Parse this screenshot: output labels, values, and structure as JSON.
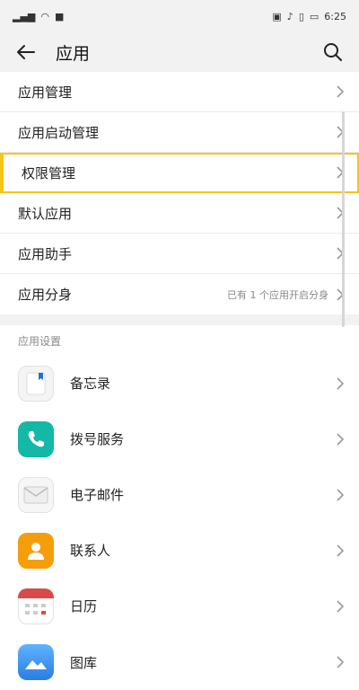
{
  "status": {
    "time": "6:25",
    "left_icons": [
      "signal-icon",
      "wifi-icon",
      "notification-icon"
    ],
    "right_icons": [
      "screenshot-icon",
      "mute-icon",
      "vibrate-icon",
      "battery-icon"
    ]
  },
  "header": {
    "title": "应用"
  },
  "menu": [
    {
      "label": "应用管理"
    },
    {
      "label": "应用启动管理"
    },
    {
      "label": "权限管理"
    },
    {
      "label": "默认应用"
    },
    {
      "label": "应用助手"
    },
    {
      "label": "应用分身",
      "sub": "已有 1 个应用开启分身"
    }
  ],
  "section_title": "应用设置",
  "apps": [
    {
      "label": "备忘录",
      "icon": "memo-icon"
    },
    {
      "label": "拨号服务",
      "icon": "phone-icon"
    },
    {
      "label": "电子邮件",
      "icon": "email-icon"
    },
    {
      "label": "联系人",
      "icon": "contacts-icon"
    },
    {
      "label": "日历",
      "icon": "calendar-icon"
    },
    {
      "label": "图库",
      "icon": "gallery-icon"
    }
  ],
  "colors": {
    "highlight": "#f5c518",
    "phone": "#14b8a6",
    "contacts": "#f59e0b",
    "calendar": "#d94b4b"
  }
}
